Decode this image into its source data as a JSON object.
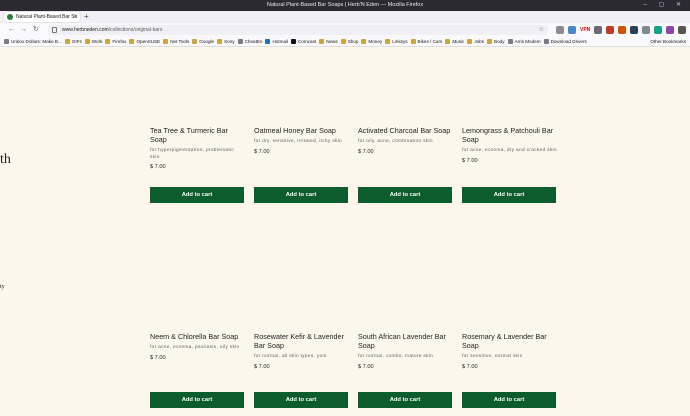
{
  "window": {
    "title": "Natural Plant-Based Bar Soaps | Herb'N Eden — Mozilla Firefox"
  },
  "tab": {
    "label": "Natural Plant-Based Bar So",
    "new_tab": "+"
  },
  "nav": {
    "back": "←",
    "forward": "→",
    "reload": "↻",
    "url_host": "www.herbneden.com",
    "url_path": "/collections/original-bars",
    "vpn_label": "VPN"
  },
  "bookmarks": {
    "items": [
      {
        "label": "Unbox Dollars: Make B...",
        "type": "link"
      },
      {
        "label": "GIFs",
        "type": "folder"
      },
      {
        "label": "Work",
        "type": "folder"
      },
      {
        "label": "Firefox",
        "type": "folder"
      },
      {
        "label": "OpenSUSE",
        "type": "folder"
      },
      {
        "label": "Net Tools",
        "type": "folder"
      },
      {
        "label": "Google",
        "type": "folder"
      },
      {
        "label": "Sony",
        "type": "folder"
      },
      {
        "label": "CheatEn",
        "type": "link"
      },
      {
        "label": "Hotmail",
        "type": "link"
      },
      {
        "label": "Comcast",
        "type": "link"
      },
      {
        "label": "News",
        "type": "folder"
      },
      {
        "label": "Shop",
        "type": "folder"
      },
      {
        "label": "Money",
        "type": "folder"
      },
      {
        "label": "Linksys",
        "type": "folder"
      },
      {
        "label": "Bikes / Cars",
        "type": "folder"
      },
      {
        "label": "Music",
        "type": "folder"
      },
      {
        "label": "Jobs",
        "type": "folder"
      },
      {
        "label": "Body",
        "type": "folder"
      },
      {
        "label": "Arris Modem",
        "type": "link"
      },
      {
        "label": "Download Drivers",
        "type": "link"
      }
    ],
    "other": "Other Bookmarks"
  },
  "page": {
    "edge_text_1": "th",
    "edge_text_2": "ty",
    "add_to_cart_label": "Add to cart",
    "products": [
      {
        "name": "Tea Tree & Turmeric Bar Soap",
        "desc": "for hyperpigmentation, problematic skin",
        "price": "$ 7.00"
      },
      {
        "name": "Oatmeal Honey Bar Soap",
        "desc": "for dry, sensitive, irritated, itchy skin",
        "price": "$ 7.00"
      },
      {
        "name": "Activated Charcoal Bar Soap",
        "desc": "for oily, acne, combination skin",
        "price": "$ 7.00"
      },
      {
        "name": "Lemongrass & Patchouli Bar Soap",
        "desc": "for acne, eczema, dry and cracked skin",
        "price": "$ 7.00"
      },
      {
        "name": "Neem & Chlorella Bar Soap",
        "desc": "for acne, eczema, psoriasis, oily skin",
        "price": "$ 7.00"
      },
      {
        "name": "Rosewater Kefir & Lavender Bar Soap",
        "desc": "for normal, all skin types, yoni",
        "price": "$ 7.00"
      },
      {
        "name": "South African Lavender Bar Soap",
        "desc": "for normal, combo, mature skin",
        "price": "$ 7.00"
      },
      {
        "name": "Rosemary & Lavender Bar Soap",
        "desc": "for sensitive, normal skin",
        "price": "$ 7.00"
      }
    ]
  }
}
